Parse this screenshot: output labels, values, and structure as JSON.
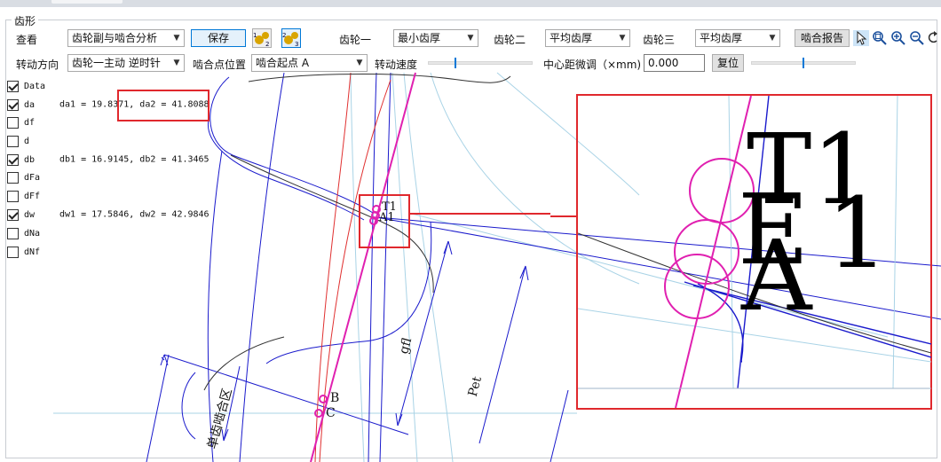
{
  "group_title": "齿形",
  "toolbar_row1": {
    "view_label": "查看",
    "view_value": "齿轮副与啮合分析",
    "save_label": "保存",
    "gear1_label": "齿轮一",
    "gear1_value": "最小齿厚",
    "gear2_label": "齿轮二",
    "gear2_value": "平均齿厚",
    "gear3_label": "齿轮三",
    "gear3_value": "平均齿厚",
    "report_label": "啮合报告"
  },
  "toolbar_row2": {
    "direction_label": "转动方向",
    "direction_value": "齿轮一主动 逆时针",
    "mesh_point_label": "啮合点位置",
    "mesh_point_value": "啮合起点 A",
    "speed_label": "转动速度",
    "center_adjust_label": "中心距微调（×mm)",
    "center_adjust_value": "0.000",
    "reset_label": "复位"
  },
  "checkboxes": [
    {
      "name": "Data",
      "checked": true,
      "value": ""
    },
    {
      "name": "da",
      "checked": true,
      "value": "da1 = 19.8371,  da2 = 41.8088"
    },
    {
      "name": "df",
      "checked": false,
      "value": ""
    },
    {
      "name": "d",
      "checked": false,
      "value": ""
    },
    {
      "name": "db",
      "checked": true,
      "value": "db1 = 16.9145,  db2 = 41.3465"
    },
    {
      "name": "dFa",
      "checked": false,
      "value": ""
    },
    {
      "name": "dFf",
      "checked": false,
      "value": ""
    },
    {
      "name": "dw",
      "checked": true,
      "value": "dw1 = 17.5846,  dw2 = 42.9846"
    },
    {
      "name": "dNa",
      "checked": false,
      "value": ""
    },
    {
      "name": "dNf",
      "checked": false,
      "value": ""
    }
  ],
  "canvas_labels": {
    "t1": "T1",
    "a1": "A1",
    "gfl": "gfl",
    "pet": "Pet",
    "b": "B",
    "c": "C",
    "mesh_zone": "单齿啮合区"
  },
  "zoom_labels": {
    "t1": "T1",
    "a": "A",
    "e": "E",
    "one": "1"
  },
  "colors": {
    "accent": "#0078d7",
    "highlight_box": "#e0282d",
    "line_of_action": "#e020b0",
    "gear_blue": "#1a1acc"
  }
}
